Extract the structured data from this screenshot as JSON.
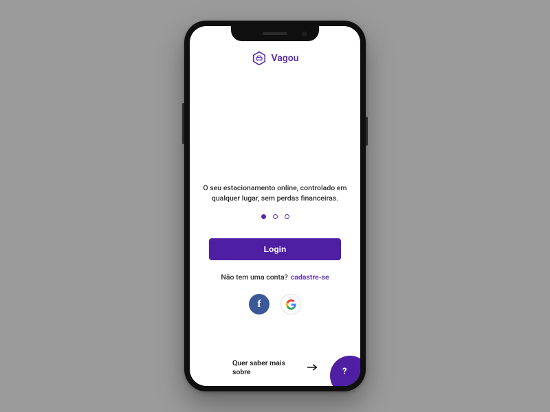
{
  "brand": {
    "name": "Vagou"
  },
  "tagline": "O seu estacionamento online, controlado em qualquer lugar, sem perdas financeiras.",
  "carousel": {
    "count": 3,
    "active_index": 0
  },
  "auth": {
    "login_label": "Login",
    "signup_prompt": "Não tem uma conta?",
    "signup_link": "cadastre-se"
  },
  "social": {
    "facebook_glyph": "f",
    "google_glyph": "G"
  },
  "footer": {
    "learn_more": "Quer saber mais sobre",
    "help_glyph": "?"
  },
  "colors": {
    "brand_purple": "#5c2fb0",
    "button_purple": "#4f1fa3",
    "facebook_blue": "#3b5998",
    "page_bg": "#9b9b9b"
  }
}
